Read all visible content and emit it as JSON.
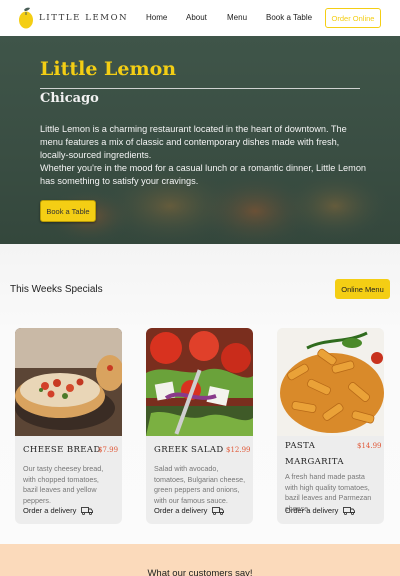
{
  "header": {
    "brand": "LITTLE LEMON",
    "nav": [
      "Home",
      "About",
      "Menu",
      "Book a Table"
    ],
    "cta": "Order Online"
  },
  "hero": {
    "title": "Little Lemon",
    "subtitle": "Chicago",
    "description": [
      "Little Lemon is a charming restaurant located in the heart of downtown. The menu features a mix of classic and contemporary dishes made with fresh, locally-sourced ingredients.",
      "Whether you're in the mood for a casual lunch or a romantic dinner, Little Lemon has something to satisfy your cravings."
    ],
    "button": "Book a Table"
  },
  "specials": {
    "title": "This Weeks Specials",
    "button": "Online Menu",
    "cards": [
      {
        "name": "CHEESE BREAD",
        "price": "$7.99",
        "description": "Our tasty cheesey bread, with chopped tomatoes, bazil leaves and yellow peppers.",
        "order": "Order a delivery"
      },
      {
        "name": "GREEK SALAD",
        "price": "$12.99",
        "description": "Salad with avocado, tomatoes, Bulgarian cheese, green peppers and onions, with our famous sauce.",
        "order": "Order a delivery"
      },
      {
        "name": "PASTA MARGARITA",
        "price": "$14.99",
        "description": "A fresh hand made pasta with high quality tomatoes, bazil leaves and Parmezan cheese.",
        "order": "Order a delivery"
      }
    ]
  },
  "testimonials": {
    "title": "What our customers say!"
  },
  "colors": {
    "accent": "#F4CE14",
    "hero_bg": "#495E57",
    "price": "#e05a3a",
    "testimonial_bg": "#FBDABB"
  }
}
